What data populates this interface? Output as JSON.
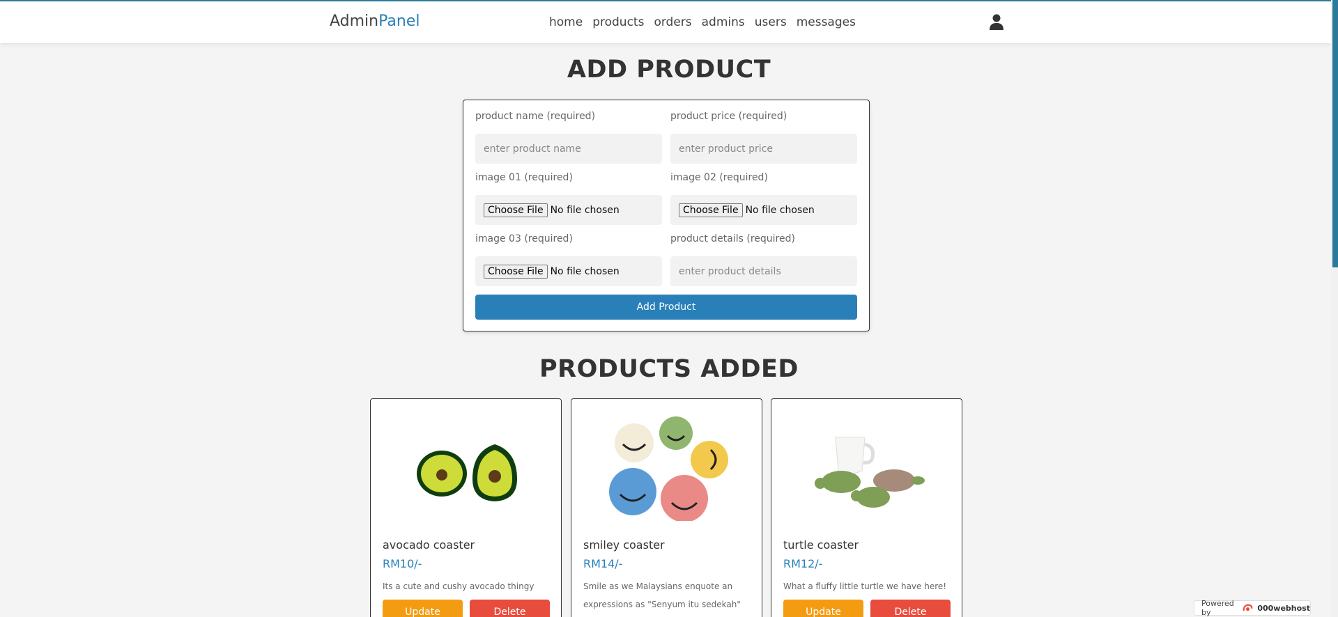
{
  "header": {
    "logo_main": "Admin",
    "logo_accent": "Panel",
    "nav": [
      "home",
      "products",
      "orders",
      "admins",
      "users",
      "messages"
    ]
  },
  "add_product": {
    "title": "ADD PRODUCT",
    "name_label": "product name (required)",
    "name_placeholder": "enter product name",
    "price_label": "product price (required)",
    "price_placeholder": "enter product price",
    "image1_label": "image 01 (required)",
    "image2_label": "image 02 (required)",
    "image3_label": "image 03 (required)",
    "details_label": "product details (required)",
    "details_placeholder": "enter product details",
    "choose_file": "Choose File",
    "no_file": "No file chosen",
    "submit": "Add Product"
  },
  "products": {
    "title": "PRODUCTS ADDED",
    "update_label": "Update",
    "delete_label": "Delete",
    "items": [
      {
        "name": "avocado coaster",
        "price": "RM10/-",
        "description": "Its a cute and cushy avocado thingy"
      },
      {
        "name": "smiley coaster",
        "price": "RM14/-",
        "description": "Smile as we Malaysians enquote an expressions as \"Senyum itu sedekah\""
      },
      {
        "name": "turtle coaster",
        "price": "RM12/-",
        "description": "What a fluffy little turtle we have here!"
      }
    ]
  },
  "footer_badge": {
    "prefix": "Powered by",
    "brand": "000webhost"
  },
  "colors": {
    "accent": "#2980b9",
    "update": "#f39c12",
    "delete": "#e74c3c"
  }
}
